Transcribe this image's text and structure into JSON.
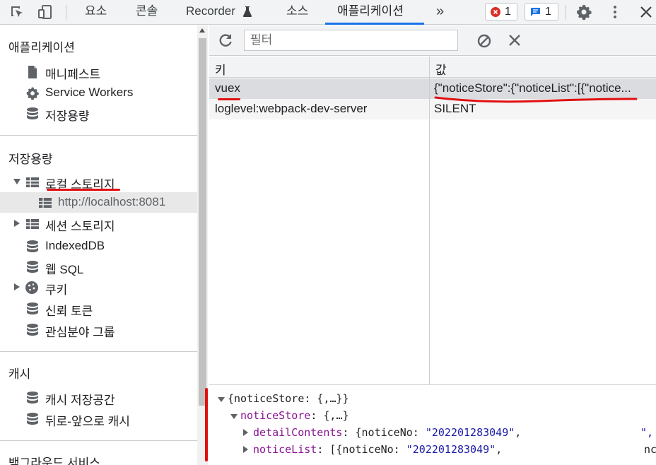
{
  "toolbar": {
    "tabs": [
      "요소",
      "콘솔",
      "Recorder",
      "소스",
      "애플리케이션"
    ],
    "more": "»",
    "errors_count": "1",
    "messages_count": "1"
  },
  "sidebar": {
    "app_section": "애플리케이션",
    "app_items": [
      "매니페스트",
      "Service Workers",
      "저장용량"
    ],
    "storage_section": "저장용량",
    "storage_items": [
      "로컬 스토리지",
      "http://localhost:8081",
      "세션 스토리지",
      "IndexedDB",
      "웹 SQL",
      "쿠키",
      "신뢰 토큰",
      "관심분야 그룹"
    ],
    "cache_section": "캐시",
    "cache_items": [
      "캐시 저장공간",
      "뒤로-앞으로 캐시"
    ],
    "bg_section": "백그라운드 서비스"
  },
  "main": {
    "filter_placeholder": "필터",
    "col_key": "키",
    "col_value": "값",
    "rows": [
      {
        "key": "vuex",
        "value": "{\"noticeStore\":{\"noticeList\":[{\"notice..."
      },
      {
        "key": "loglevel:webpack-dev-server",
        "value": "SILENT"
      }
    ]
  },
  "preview": {
    "root": "{noticeStore: {,…}}",
    "notice_key": "noticeStore",
    "notice_rest": ": {,…}",
    "detail_key": "detailContents",
    "detail_rest": ": {noticeNo: ",
    "detail_val": "\"202201283049\"",
    "detail_tail": ",",
    "detail_edge": "\",",
    "list_key": "noticeList",
    "list_rest": ": [{noticeNo: ",
    "list_val": "\"202201283049\"",
    "list_tail": ",",
    "list_edge": "nc"
  },
  "colors": {
    "accent": "#1a73e8",
    "annotation": "#e01010",
    "error": "#d93025"
  }
}
